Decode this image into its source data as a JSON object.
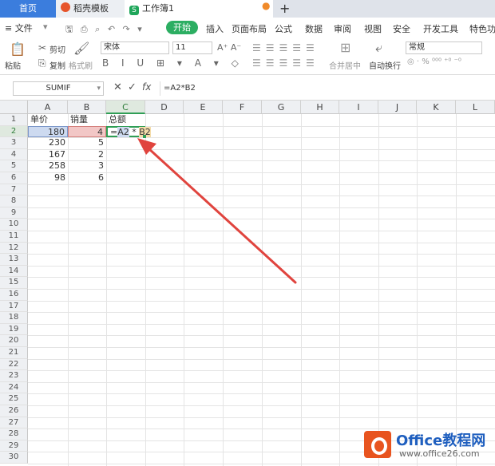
{
  "tabs": {
    "home": "首页",
    "doc_template": "稻壳模板",
    "workbook": "工作簿1",
    "workbook_icon": "S",
    "new_tab": "+"
  },
  "menu": {
    "file": "≡ 文件",
    "start": "开始",
    "items": [
      "插入",
      "页面布局",
      "公式",
      "数据",
      "审阅",
      "视图",
      "安全",
      "开发工具",
      "特色功能"
    ]
  },
  "toolbar": {
    "paste": "粘贴",
    "cut": "剪切",
    "copy": "复制",
    "format_painter": "格式刷",
    "font_name": "宋体",
    "font_size": "11",
    "merge_center": "合并居中",
    "auto_wrap": "自动换行",
    "number_format": "常规"
  },
  "formula_bar": {
    "name_box": "SUMIF",
    "formula": "=A2*B2",
    "fx": "fx"
  },
  "columns": [
    "A",
    "B",
    "C",
    "D",
    "E",
    "F",
    "G",
    "H",
    "I",
    "J",
    "K",
    "L"
  ],
  "rows": [
    "1",
    "2",
    "3",
    "4",
    "5",
    "6",
    "7",
    "8",
    "9",
    "10",
    "11",
    "12",
    "13",
    "14",
    "15",
    "16",
    "17",
    "18",
    "19",
    "20",
    "21",
    "22",
    "23",
    "24",
    "25",
    "26",
    "27",
    "28",
    "29",
    "30"
  ],
  "sheet": {
    "headers": {
      "a": "单价",
      "b": "销量",
      "c": "总额"
    },
    "data": [
      {
        "a": "180",
        "b": "4"
      },
      {
        "a": "230",
        "b": "5"
      },
      {
        "a": "167",
        "b": "2"
      },
      {
        "a": "258",
        "b": "3"
      },
      {
        "a": "98",
        "b": "6"
      }
    ],
    "editing_cell": {
      "prefix": "=",
      "ref1": "A2",
      "op": " * ",
      "ref2": "B2"
    }
  },
  "watermark": {
    "title": "Office教程网",
    "url": "www.office26.com"
  },
  "colors": {
    "accent_green": "#2cae62",
    "arrow_red": "#e0443e",
    "home_tab": "#3b7ddd"
  }
}
